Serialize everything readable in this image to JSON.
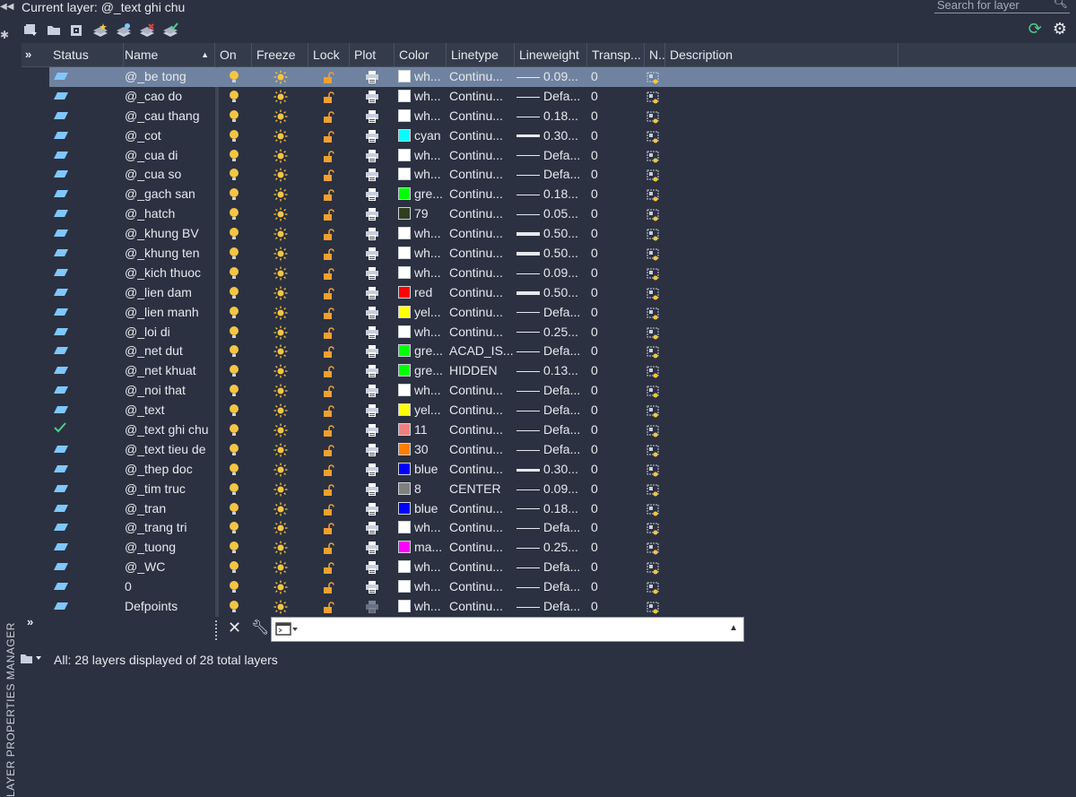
{
  "header": {
    "current_layer": "Current layer: @_text ghi chu",
    "search_placeholder": "Search for layer"
  },
  "vertical_title": "LAYER PROPERTIES MANAGER",
  "columns": {
    "status": "Status",
    "name": "Name",
    "on": "On",
    "freeze": "Freeze",
    "lock": "Lock",
    "plot": "Plot",
    "color": "Color",
    "linetype": "Linetype",
    "lineweight": "Lineweight",
    "transparency": "Transp...",
    "new_vp": "N..",
    "description": "Description"
  },
  "layers": [
    {
      "name": "@_be tong",
      "color_label": "wh...",
      "color_hex": "#ffffff",
      "linetype": "Continu...",
      "lineweight": "0.09...",
      "lw_thick": 1,
      "transparency": "0",
      "current": false,
      "selected": true
    },
    {
      "name": "@_cao do",
      "color_label": "wh...",
      "color_hex": "#ffffff",
      "linetype": "Continu...",
      "lineweight": "Defa...",
      "lw_thick": 1,
      "transparency": "0",
      "current": false,
      "selected": false
    },
    {
      "name": "@_cau thang",
      "color_label": "wh...",
      "color_hex": "#ffffff",
      "linetype": "Continu...",
      "lineweight": "0.18...",
      "lw_thick": 1,
      "transparency": "0",
      "current": false,
      "selected": false
    },
    {
      "name": "@_cot",
      "color_label": "cyan",
      "color_hex": "#00ffff",
      "linetype": "Continu...",
      "lineweight": "0.30...",
      "lw_thick": 3,
      "transparency": "0",
      "current": false,
      "selected": false
    },
    {
      "name": "@_cua di",
      "color_label": "wh...",
      "color_hex": "#ffffff",
      "linetype": "Continu...",
      "lineweight": "Defa...",
      "lw_thick": 1,
      "transparency": "0",
      "current": false,
      "selected": false
    },
    {
      "name": "@_cua so",
      "color_label": "wh...",
      "color_hex": "#ffffff",
      "linetype": "Continu...",
      "lineweight": "Defa...",
      "lw_thick": 1,
      "transparency": "0",
      "current": false,
      "selected": false
    },
    {
      "name": "@_gach san",
      "color_label": "gre...",
      "color_hex": "#00ff00",
      "linetype": "Continu...",
      "lineweight": "0.18...",
      "lw_thick": 1,
      "transparency": "0",
      "current": false,
      "selected": false
    },
    {
      "name": "@_hatch",
      "color_label": "79",
      "color_hex": "#2f3f1f",
      "linetype": "Continu...",
      "lineweight": "0.05...",
      "lw_thick": 1,
      "transparency": "0",
      "current": false,
      "selected": false
    },
    {
      "name": "@_khung BV",
      "color_label": "wh...",
      "color_hex": "#ffffff",
      "linetype": "Continu...",
      "lineweight": "0.50...",
      "lw_thick": 4,
      "transparency": "0",
      "current": false,
      "selected": false
    },
    {
      "name": "@_khung ten",
      "color_label": "wh...",
      "color_hex": "#ffffff",
      "linetype": "Continu...",
      "lineweight": "0.50...",
      "lw_thick": 4,
      "transparency": "0",
      "current": false,
      "selected": false
    },
    {
      "name": "@_kich thuoc",
      "color_label": "wh...",
      "color_hex": "#ffffff",
      "linetype": "Continu...",
      "lineweight": "0.09...",
      "lw_thick": 1,
      "transparency": "0",
      "current": false,
      "selected": false
    },
    {
      "name": "@_lien dam",
      "color_label": "red",
      "color_hex": "#ff0000",
      "linetype": "Continu...",
      "lineweight": "0.50...",
      "lw_thick": 4,
      "transparency": "0",
      "current": false,
      "selected": false
    },
    {
      "name": "@_lien manh",
      "color_label": "yel...",
      "color_hex": "#ffff00",
      "linetype": "Continu...",
      "lineweight": "Defa...",
      "lw_thick": 1,
      "transparency": "0",
      "current": false,
      "selected": false
    },
    {
      "name": "@_loi di",
      "color_label": "wh...",
      "color_hex": "#ffffff",
      "linetype": "Continu...",
      "lineweight": "0.25...",
      "lw_thick": 1,
      "transparency": "0",
      "current": false,
      "selected": false
    },
    {
      "name": "@_net dut",
      "color_label": "gre...",
      "color_hex": "#00ff00",
      "linetype": "ACAD_IS...",
      "lineweight": "Defa...",
      "lw_thick": 1,
      "transparency": "0",
      "current": false,
      "selected": false
    },
    {
      "name": "@_net khuat",
      "color_label": "gre...",
      "color_hex": "#00ff00",
      "linetype": "HIDDEN",
      "lineweight": "0.13...",
      "lw_thick": 1,
      "transparency": "0",
      "current": false,
      "selected": false
    },
    {
      "name": "@_noi that",
      "color_label": "wh...",
      "color_hex": "#ffffff",
      "linetype": "Continu...",
      "lineweight": "Defa...",
      "lw_thick": 1,
      "transparency": "0",
      "current": false,
      "selected": false
    },
    {
      "name": "@_text",
      "color_label": "yel...",
      "color_hex": "#ffff00",
      "linetype": "Continu...",
      "lineweight": "Defa...",
      "lw_thick": 1,
      "transparency": "0",
      "current": false,
      "selected": false
    },
    {
      "name": "@_text ghi chu",
      "color_label": "11",
      "color_hex": "#f08080",
      "linetype": "Continu...",
      "lineweight": "Defa...",
      "lw_thick": 1,
      "transparency": "0",
      "current": true,
      "selected": false
    },
    {
      "name": "@_text tieu de",
      "color_label": "30",
      "color_hex": "#ff7f00",
      "linetype": "Continu...",
      "lineweight": "Defa...",
      "lw_thick": 1,
      "transparency": "0",
      "current": false,
      "selected": false
    },
    {
      "name": "@_thep doc",
      "color_label": "blue",
      "color_hex": "#0000ff",
      "linetype": "Continu...",
      "lineweight": "0.30...",
      "lw_thick": 3,
      "transparency": "0",
      "current": false,
      "selected": false
    },
    {
      "name": "@_tim truc",
      "color_label": "8",
      "color_hex": "#808080",
      "linetype": "CENTER",
      "lineweight": "0.09...",
      "lw_thick": 1,
      "transparency": "0",
      "current": false,
      "selected": false
    },
    {
      "name": "@_tran",
      "color_label": "blue",
      "color_hex": "#0000ff",
      "linetype": "Continu...",
      "lineweight": "0.18...",
      "lw_thick": 1,
      "transparency": "0",
      "current": false,
      "selected": false
    },
    {
      "name": "@_trang tri",
      "color_label": "wh...",
      "color_hex": "#ffffff",
      "linetype": "Continu...",
      "lineweight": "Defa...",
      "lw_thick": 1,
      "transparency": "0",
      "current": false,
      "selected": false
    },
    {
      "name": "@_tuong",
      "color_label": "ma...",
      "color_hex": "#ff00ff",
      "linetype": "Continu...",
      "lineweight": "0.25...",
      "lw_thick": 1,
      "transparency": "0",
      "current": false,
      "selected": false
    },
    {
      "name": "@_WC",
      "color_label": "wh...",
      "color_hex": "#ffffff",
      "linetype": "Continu...",
      "lineweight": "Defa...",
      "lw_thick": 1,
      "transparency": "0",
      "current": false,
      "selected": false
    },
    {
      "name": "0",
      "color_label": "wh...",
      "color_hex": "#ffffff",
      "linetype": "Continu...",
      "lineweight": "Defa...",
      "lw_thick": 1,
      "transparency": "0",
      "current": false,
      "selected": false
    },
    {
      "name": "Defpoints",
      "color_label": "wh...",
      "color_hex": "#ffffff",
      "linetype": "Continu...",
      "lineweight": "Defa...",
      "lw_thick": 1,
      "transparency": "0",
      "current": false,
      "selected": false,
      "plot_disabled": true
    }
  ],
  "status_bar": {
    "text": "All: 28 layers displayed of 28 total layers"
  },
  "icons": {
    "on": "lightbulb-icon",
    "freeze": "sun-icon",
    "lock": "padlock-icon",
    "plot": "printer-icon",
    "newvp": "viewport-freeze-icon",
    "status_layer": "layer-parallelogram-icon",
    "status_current": "checkmark-icon"
  },
  "colors": {
    "bg": "#2b3140",
    "header": "#343b4b",
    "selected_row": "#6f829f",
    "bulb": "#f5c542",
    "lock": "#f0a030",
    "plot": "#c8d0e0",
    "status_layer": "#7fc7ff",
    "check": "#4cd08a"
  }
}
